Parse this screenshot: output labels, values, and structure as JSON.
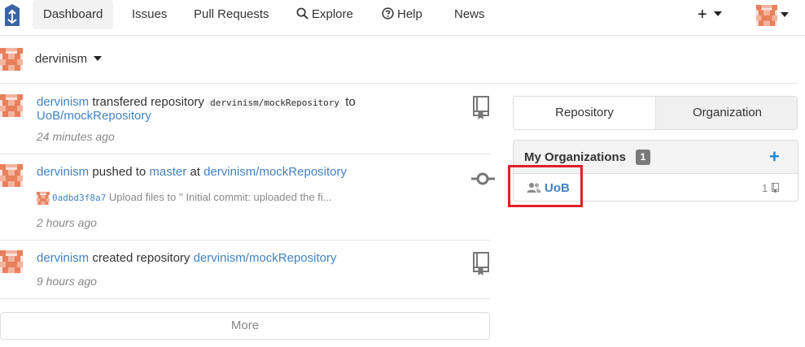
{
  "nav": {
    "items": [
      "Dashboard",
      "Issues",
      "Pull Requests",
      "Explore",
      "Help",
      "News"
    ],
    "create_label": "+"
  },
  "context": {
    "user": "dervinism"
  },
  "feed": [
    {
      "actor": "dervinism",
      "action": "transfered repository",
      "repo_code": "dervinism/mockRepository",
      "connector": "to",
      "target": "UoB/mockRepository",
      "time": "24 minutes ago",
      "icon": "repo-icon"
    },
    {
      "actor": "dervinism",
      "action": "pushed to",
      "branch": "master",
      "connector": "at",
      "target": "dervinism/mockRepository",
      "commit_sha": "0adbd3f8a7",
      "commit_msg": "Upload files to '' Initial commit: uploaded the fi...",
      "time": "2 hours ago",
      "icon": "commit-icon"
    },
    {
      "actor": "dervinism",
      "action": "created repository",
      "target": "dervinism/mockRepository",
      "time": "9 hours ago",
      "icon": "repo-icon"
    }
  ],
  "more_label": "More",
  "tabs": [
    "Repository",
    "Organization"
  ],
  "orgs": {
    "title": "My Organizations",
    "count": "1",
    "add": "+",
    "items": [
      {
        "name": "UoB",
        "repo_count": "1"
      }
    ]
  },
  "colors": {
    "link": "#4183c4",
    "highlight": "#e0202a",
    "accent": "#2185d0"
  }
}
